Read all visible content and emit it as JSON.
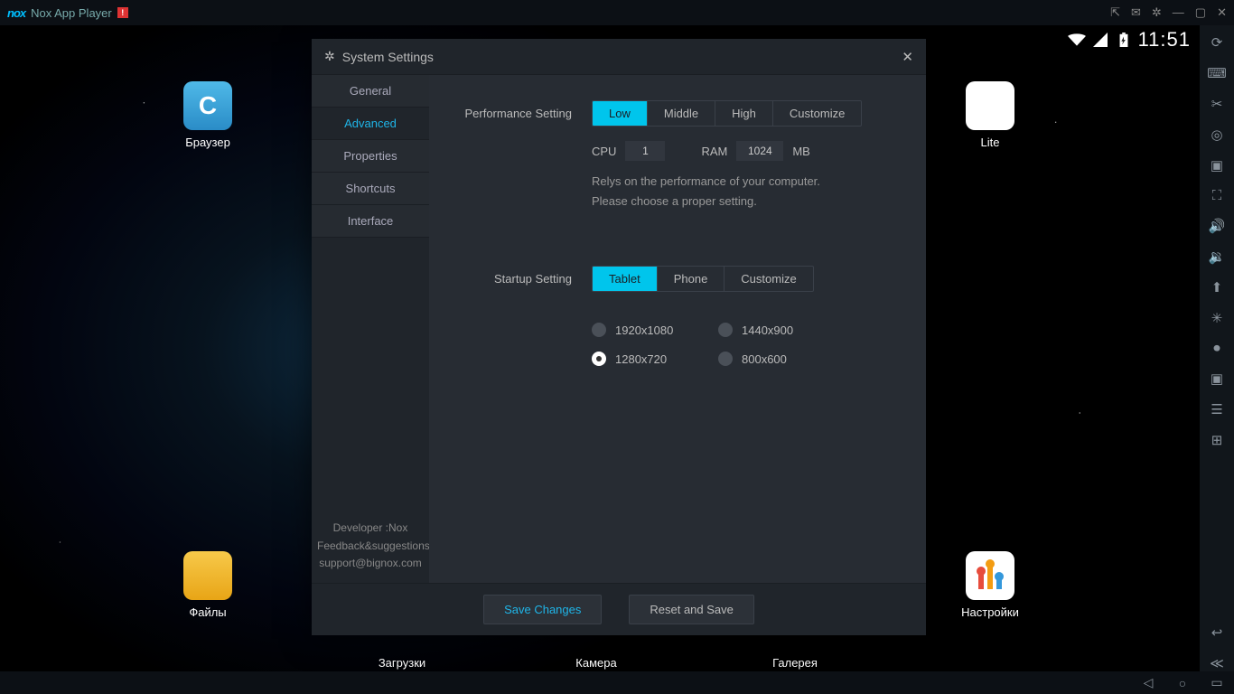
{
  "titlebar": {
    "logo": "nox",
    "title": "Nox App Player"
  },
  "statusbar": {
    "time": "11:51"
  },
  "apps": {
    "browser": "Браузер",
    "lite": "Lite",
    "files": "Файлы",
    "settings_app": "Настройки",
    "downloads": "Загрузки",
    "camera": "Камера",
    "gallery": "Галерея"
  },
  "modal": {
    "title": "System Settings",
    "tabs": {
      "general": "General",
      "advanced": "Advanced",
      "properties": "Properties",
      "shortcuts": "Shortcuts",
      "interface": "Interface"
    },
    "perf": {
      "label": "Performance Setting",
      "low": "Low",
      "middle": "Middle",
      "high": "High",
      "customize": "Customize",
      "cpu_label": "CPU",
      "cpu_value": "1",
      "ram_label": "RAM",
      "ram_value": "1024",
      "ram_unit": "MB",
      "hint1": "Relys on the performance of your computer.",
      "hint2": "Please choose a proper setting."
    },
    "start": {
      "label": "Startup Setting",
      "tablet": "Tablet",
      "phone": "Phone",
      "customize": "Customize",
      "res1": "1920x1080",
      "res2": "1440x900",
      "res3": "1280x720",
      "res4": "800x600"
    },
    "footer": {
      "developer": "Developer :Nox",
      "feedback": "Feedback&suggestions:",
      "email": "support@bignox.com",
      "save": "Save Changes",
      "reset": "Reset and Save"
    }
  }
}
